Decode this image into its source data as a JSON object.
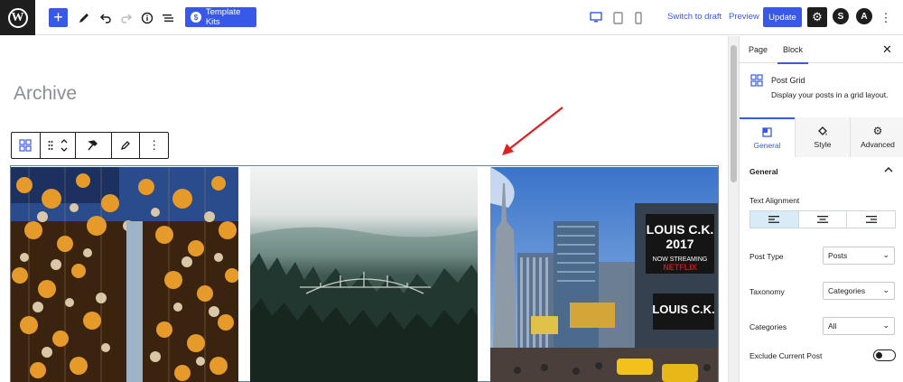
{
  "topbar": {
    "add_block_label": "+",
    "template_kits_label": "Template Kits",
    "switch_to_draft_label": "Switch to draft",
    "preview_label": "Preview",
    "update_label": "Update",
    "logo_letter": "W",
    "astra_letter": "A",
    "s_letter": "S",
    "settings_glyph": "⚙",
    "more_glyph": "⋮"
  },
  "editor": {
    "page_title": "Archive",
    "accent_color": "#2f95c9"
  },
  "sidebar": {
    "tabs": [
      {
        "label": "Page",
        "active": false
      },
      {
        "label": "Block",
        "active": true
      }
    ],
    "close_glyph": "✕",
    "block_name": "Post Grid",
    "block_description": "Display your posts in a grid layout.",
    "sub_tabs": [
      {
        "label": "General",
        "active": true
      },
      {
        "label": "Style",
        "active": false
      },
      {
        "label": "Advanced",
        "active": false
      }
    ],
    "section_title": "General",
    "text_alignment_label": "Text Alignment",
    "text_alignment_selected": "left",
    "post_type_label": "Post Type",
    "post_type_value": "Posts",
    "taxonomy_label": "Taxonomy",
    "taxonomy_value": "Categories",
    "categories_label": "Categories",
    "categories_value": "All",
    "exclude_current_label": "Exclude Current Post",
    "exclude_current_on": false
  },
  "colors": {
    "primary": "#3858e9",
    "dark": "#1e1e1e",
    "arrow": "#e02020"
  }
}
